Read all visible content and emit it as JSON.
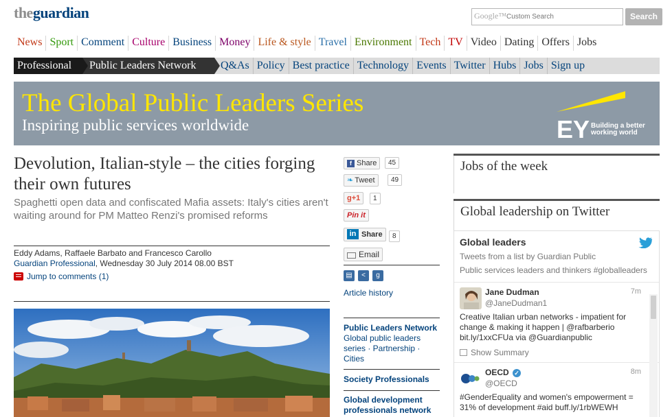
{
  "header": {
    "logo_the": "the",
    "logo_guardian": "guardian",
    "search_placeholder": "Custom Search",
    "search_google": "Google™",
    "search_button": "Search"
  },
  "primary_nav": [
    {
      "label": "News",
      "color": "#c13716"
    },
    {
      "label": "Sport",
      "color": "#349a0d"
    },
    {
      "label": "Comment",
      "color": "#04437c"
    },
    {
      "label": "Culture",
      "color": "#a7006b"
    },
    {
      "label": "Business",
      "color": "#04437c"
    },
    {
      "label": "Money",
      "color": "#7d0068"
    },
    {
      "label": "Life & style",
      "color": "#b9561d"
    },
    {
      "label": "Travel",
      "color": "#2a6fa8"
    },
    {
      "label": "Environment",
      "color": "#4a7801"
    },
    {
      "label": "Tech",
      "color": "#c13716"
    },
    {
      "label": "TV",
      "color": "#c10000"
    },
    {
      "label": "Video",
      "color": "#333333"
    },
    {
      "label": "Dating",
      "color": "#333333"
    },
    {
      "label": "Offers",
      "color": "#333333"
    },
    {
      "label": "Jobs",
      "color": "#333333"
    }
  ],
  "secondary_nav": {
    "crumb_professional": "Professional",
    "crumb_section": "Public Leaders Network",
    "items": [
      "Q&As",
      "Policy",
      "Best practice",
      "Technology",
      "Events",
      "Twitter",
      "Hubs",
      "Jobs",
      "Sign up"
    ]
  },
  "banner": {
    "title": "The Global Public Leaders Series",
    "subtitle": "Inspiring public services worldwide",
    "sponsor_logo": "EY",
    "sponsor_tagline_1": "Building a better",
    "sponsor_tagline_2": "working world"
  },
  "article": {
    "title": "Devolution, Italian-style – the cities forging their own futures",
    "standfirst": "Spaghetti open data and confiscated Mafia assets: Italy's cities aren't waiting around for PM Matteo Renzi's promised reforms",
    "byline": "Eddy Adams, Raffaele Barbato and Francesco Carollo",
    "source": "Guardian Professional",
    "date": ", Wednesday 30 July 2014 08.00 BST",
    "comments_link": "Jump to comments (1)"
  },
  "share": {
    "facebook_label": "Share",
    "facebook_count": "45",
    "twitter_label": "Tweet",
    "twitter_count": "49",
    "gplus_label": "+1",
    "gplus_count": "1",
    "pinterest_label": "Pin it",
    "linkedin_label": "Share",
    "linkedin_count": "8",
    "email_label": "Email",
    "article_history": "Article history"
  },
  "related": [
    {
      "head": "Public Leaders Network",
      "text": "Global public leaders series · Partnership · Cities"
    },
    {
      "head": "Society Professionals",
      "text": ""
    },
    {
      "head": "Global development professionals network",
      "text": ""
    }
  ],
  "right": {
    "jobs_heading": "Jobs of the week",
    "twitter_heading": "Global leadership on Twitter",
    "widget_title": "Global leaders",
    "widget_sub1": "Tweets from a list by Guardian Public",
    "widget_sub2": "Public services leaders and thinkers #globalleaders",
    "tweets": [
      {
        "name": "Jane Dudman",
        "handle": "@JaneDudman1",
        "time": "7m",
        "text": "Creative Italian urban networks - impatient for change & making it happen | @rafbarberio bit.ly/1xxCFUa  via @Guardianpublic",
        "summary": "Show Summary"
      },
      {
        "name": "OECD",
        "handle": "@OECD",
        "time": "8m",
        "text": "#GenderEquality and women's empowerment = 31% of development #aid buff.ly/1rbWEWH",
        "summary": ""
      }
    ]
  }
}
